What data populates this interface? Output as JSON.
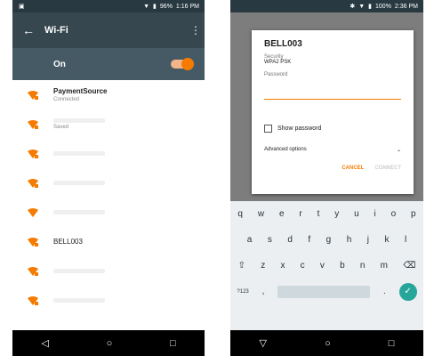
{
  "colors": {
    "accent": "#f57c00",
    "toolbar": "#37474f",
    "statusbar": "#283941",
    "on_bar": "#455a64",
    "ok_key": "#26a69a"
  },
  "left": {
    "status_time": "1:16 PM",
    "status_battery": "96%",
    "toolbar_title": "Wi-Fi",
    "on_label": "On",
    "networks": [
      {
        "name": "PaymentSource",
        "status": "Connected",
        "icon": "wifi-lock-icon"
      },
      {
        "name": "",
        "status": "Saved",
        "icon": "wifi-lock-icon"
      },
      {
        "name": "",
        "status": "",
        "icon": "wifi-lock-icon"
      },
      {
        "name": "",
        "status": "",
        "icon": "wifi-lock-icon"
      },
      {
        "name": "",
        "status": "",
        "icon": "wifi-icon"
      },
      {
        "name": "BELL003",
        "status": "",
        "icon": "wifi-lock-icon"
      },
      {
        "name": "",
        "status": "",
        "icon": "wifi-lock-icon"
      },
      {
        "name": "",
        "status": "",
        "icon": "wifi-lock-icon"
      }
    ]
  },
  "right": {
    "status_time": "2:36 PM",
    "status_battery": "100%",
    "dialog": {
      "title": "BELL003",
      "security_label": "Security",
      "security_value": "WPA2 PSK",
      "password_label": "Password",
      "show_password": "Show password",
      "advanced": "Advanced options",
      "cancel": "CANCEL",
      "connect": "CONNECT"
    },
    "keyboard": {
      "row1": [
        "q",
        "w",
        "e",
        "r",
        "t",
        "y",
        "u",
        "i",
        "o",
        "p"
      ],
      "row2": [
        "a",
        "s",
        "d",
        "f",
        "g",
        "h",
        "j",
        "k",
        "l"
      ],
      "row3": [
        "z",
        "x",
        "c",
        "v",
        "b",
        "n",
        "m"
      ],
      "symbols": "?123",
      "comma": ",",
      "period": "."
    }
  }
}
